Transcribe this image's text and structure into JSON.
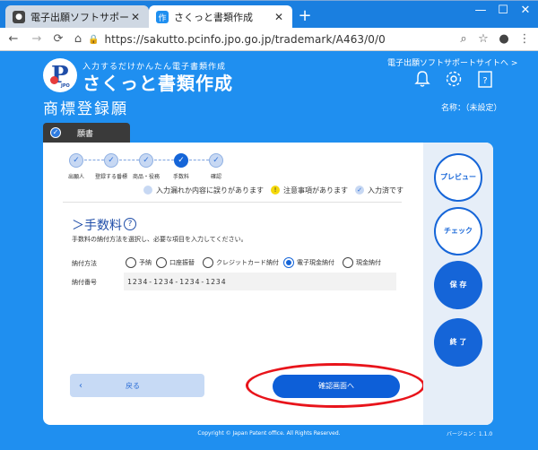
{
  "browser": {
    "tabs": [
      {
        "title": "電子出願ソフトサポートサイト さくっ"
      },
      {
        "title": "さくっと書類作成"
      }
    ],
    "new_tab": "+",
    "tab_close": "✕",
    "url": "https://sakutto.pcinfo.jpo.go.jp/trademark/A463/0/0",
    "window": {
      "minimize": "—",
      "maximize": "☐",
      "close": "✕"
    }
  },
  "header": {
    "tagline": "入力するだけかんたん電子書類作成",
    "logo_name": "さくっと書類作成",
    "logo_jpo": "JPO",
    "support_link": "電子出願ソフトサポートサイトへ >",
    "page_title": "商標登録願",
    "name_label": "名称：（未設定）"
  },
  "doc_tab": {
    "label": "願書"
  },
  "steps": {
    "items": [
      {
        "label": "出願人"
      },
      {
        "label": "登録する番標"
      },
      {
        "label": "商品・役務"
      },
      {
        "label": "手数料"
      },
      {
        "label": "確認"
      }
    ],
    "check_mark": "✓"
  },
  "legend": {
    "error": "入力漏れか内容に誤りがあります",
    "warning": "注意事項があります",
    "done": "入力済です",
    "warning_mark": "!",
    "done_mark": "✓"
  },
  "section": {
    "title": "＞手数料",
    "help": "?",
    "description": "手数料の納付方法を選択し、必要な項目を入力してください。"
  },
  "payment": {
    "label": "納付方法",
    "options": [
      {
        "label": "予納"
      },
      {
        "label": "口座振替"
      },
      {
        "label": "クレジットカード納付"
      },
      {
        "label": "電子現金納付"
      },
      {
        "label": "現金納付"
      }
    ],
    "selected": "電子現金納付"
  },
  "payment_number": {
    "label": "納付番号",
    "value": "1234-1234-1234-1234"
  },
  "buttons": {
    "back": "戻る",
    "back_chevron": "‹",
    "confirm": "確認画面へ",
    "preview": "プレビュー",
    "check": "チェック",
    "save": "保 存",
    "exit": "終 了"
  },
  "footer": {
    "copyright": "Copyright © Japan Patent office. All Rights Reserved.",
    "version": "バージョン：1.1.0"
  },
  "colors": {
    "page_bg": "#1f8ff0",
    "primary": "#1565d8",
    "highlight_oval": "#e8141b"
  }
}
